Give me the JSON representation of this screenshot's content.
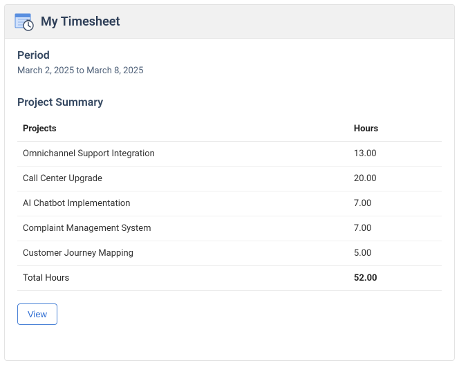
{
  "header": {
    "title": "My Timesheet",
    "icon": "timesheet-calendar-clock-icon"
  },
  "period": {
    "label": "Period",
    "value": "March 2, 2025 to March 8, 2025"
  },
  "summary": {
    "heading": "Project Summary",
    "columns": {
      "project": "Projects",
      "hours": "Hours"
    },
    "rows": [
      {
        "project": "Omnichannel Support Integration",
        "hours": "13.00"
      },
      {
        "project": "Call Center Upgrade",
        "hours": "20.00"
      },
      {
        "project": "AI Chatbot Implementation",
        "hours": "7.00"
      },
      {
        "project": "Complaint Management System",
        "hours": "7.00"
      },
      {
        "project": "Customer Journey Mapping",
        "hours": "5.00"
      }
    ],
    "total": {
      "label": "Total Hours",
      "value": "52.00"
    }
  },
  "actions": {
    "view": "View"
  }
}
